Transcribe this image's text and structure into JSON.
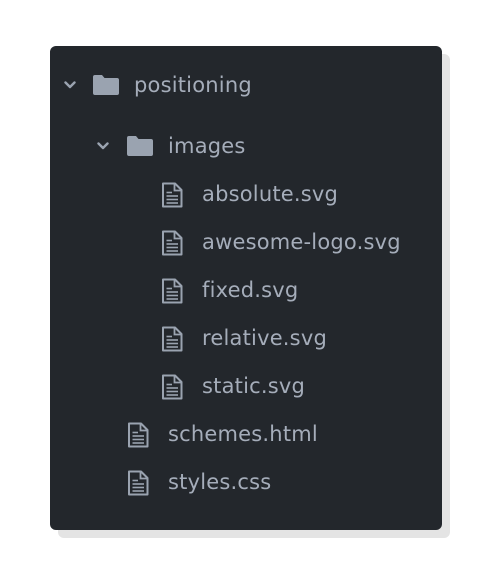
{
  "tree": {
    "root": {
      "label": "positioning",
      "icon": "folder-icon",
      "expanded": true
    },
    "images_folder": {
      "label": "images",
      "icon": "folder-icon",
      "expanded": true
    },
    "files_in_images": [
      {
        "label": "absolute.svg",
        "icon": "file-icon"
      },
      {
        "label": "awesome-logo.svg",
        "icon": "file-icon"
      },
      {
        "label": "fixed.svg",
        "icon": "file-icon"
      },
      {
        "label": "relative.svg",
        "icon": "file-icon"
      },
      {
        "label": "static.svg",
        "icon": "file-icon"
      }
    ],
    "files_in_root": [
      {
        "label": "schemes.html",
        "icon": "file-icon"
      },
      {
        "label": "styles.css",
        "icon": "file-icon"
      }
    ]
  },
  "colors": {
    "panel_background": "#23272c",
    "text": "#a5adba",
    "icon": "#9aa3b0"
  }
}
